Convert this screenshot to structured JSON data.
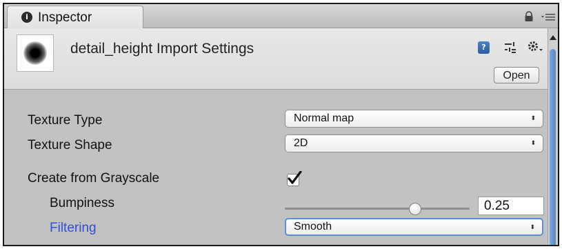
{
  "window": {
    "tab_label": "Inspector",
    "tab_icon_glyph": "i"
  },
  "header": {
    "title": "detail_height Import Settings",
    "open_label": "Open",
    "help_glyph": "?"
  },
  "settings": {
    "texture_type": {
      "label": "Texture Type",
      "value": "Normal map"
    },
    "texture_shape": {
      "label": "Texture Shape",
      "value": "2D"
    },
    "create_from_grayscale": {
      "label": "Create from Grayscale",
      "checked": true
    },
    "bumpiness": {
      "label": "Bumpiness",
      "value": "0.25",
      "slider_fraction": 0.7
    },
    "filtering": {
      "label": "Filtering",
      "value": "Smooth"
    }
  },
  "dropdown_arrow": "⬍",
  "colors": {
    "highlight_label": "#2c4fdc",
    "focus_border": "#5a8ed8"
  }
}
